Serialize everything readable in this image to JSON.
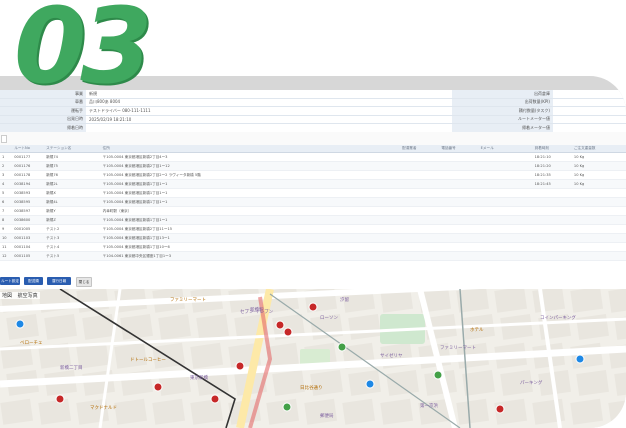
{
  "step_number": "03",
  "form": {
    "rows": [
      {
        "label": "事業",
        "value": "新規",
        "right_label": "出荷倉庫",
        "right_value": ""
      },
      {
        "label": "車番",
        "value": "品川800あ 8004",
        "right_label": "出荷数量(KPI)",
        "right_value": ""
      },
      {
        "label": "運転手",
        "value": "テストドライバー 080-111-1111",
        "right_label": "積付数量(タスク)",
        "right_value": ""
      },
      {
        "label": "出発日時",
        "value": "2025/02/19 18:21:10",
        "right_label": "ルートメーター値",
        "right_value": ""
      },
      {
        "label": "帰着日時",
        "value": "",
        "right_label": "帰着メーター値",
        "right_value": ""
      }
    ]
  },
  "grid": {
    "headers": [
      "",
      "ルートNo",
      "ステーション名",
      "住所",
      "配達業者",
      "電話番号",
      "Eメール",
      "到着時刻",
      "ご注文重量数"
    ],
    "rows": [
      [
        "1",
        "0001177",
        "新規74",
        "〒105-0004 東京都港区新橋2丁目4ー3",
        "",
        "",
        "",
        "18:21:10",
        "10 Kg"
      ],
      [
        "2",
        "0001176",
        "新規75",
        "〒105-0004 東京都港区新橋2丁目1ー12",
        "",
        "",
        "",
        "18:21:20",
        "10 Kg"
      ],
      [
        "3",
        "0001178",
        "新規76",
        "〒105-0004 東京都港区新橋2丁目2ー2 ラヴィータ新橋 5階",
        "",
        "",
        "",
        "18:21:35",
        "10 Kg"
      ],
      [
        "4",
        "0038194",
        "新規2L",
        "〒105-0004 東京都港区新橋1丁目1ー1",
        "",
        "",
        "",
        "18:21:45",
        "10 Kg"
      ],
      [
        "5",
        "0038593",
        "新規X",
        "〒105-0004 東京都港区新橋1丁目1ー1",
        "",
        "",
        "",
        "",
        ""
      ],
      [
        "6",
        "0038595",
        "新規4L",
        "〒105-0004 東京都港区新橋1丁目1ー1",
        "",
        "",
        "",
        "",
        ""
      ],
      [
        "7",
        "0038597",
        "新規Y",
        "内幸町駅（東京）",
        "",
        "",
        "",
        "",
        ""
      ],
      [
        "8",
        "0038600",
        "新規Z",
        "〒105-0004 東京都港区新橋1丁目1ー1",
        "",
        "",
        "",
        "",
        ""
      ],
      [
        "9",
        "0001005",
        "テスト2",
        "〒105-0004 東京都港区新橋2丁目11ー15",
        "",
        "",
        "",
        "",
        ""
      ],
      [
        "10",
        "0001103",
        "テスト3",
        "〒105-0004 東京都港区新橋1丁目13ー1",
        "",
        "",
        "",
        "",
        ""
      ],
      [
        "11",
        "0001104",
        "テスト4",
        "〒105-0004 東京都港区新橋1丁目10ー6",
        "",
        "",
        "",
        "",
        ""
      ],
      [
        "12",
        "0001105",
        "テスト5",
        "〒104-0061 東京都中央区銀座1丁目1ー3",
        "",
        "",
        "",
        "",
        ""
      ]
    ]
  },
  "buttons": {
    "btn1": "ルート設定",
    "btn2": "配送順",
    "btn3": "運行日報",
    "btn4": "閉じる"
  },
  "map": {
    "tab_map": "地図",
    "tab_photo": "航空写真",
    "labels": [
      "ファミリーマート",
      "セブン-イレブン",
      "ローソン",
      "ベローチェ",
      "新橋駅",
      "汐留",
      "ドトールコーヒー",
      "サイゼリヤ",
      "東京新橋",
      "ホテル",
      "パーキング",
      "新橋二丁目",
      "日比谷通り",
      "第一京浜",
      "コインパーキング",
      "マクドナルド",
      "郵便局",
      "ファミリーマート"
    ]
  }
}
